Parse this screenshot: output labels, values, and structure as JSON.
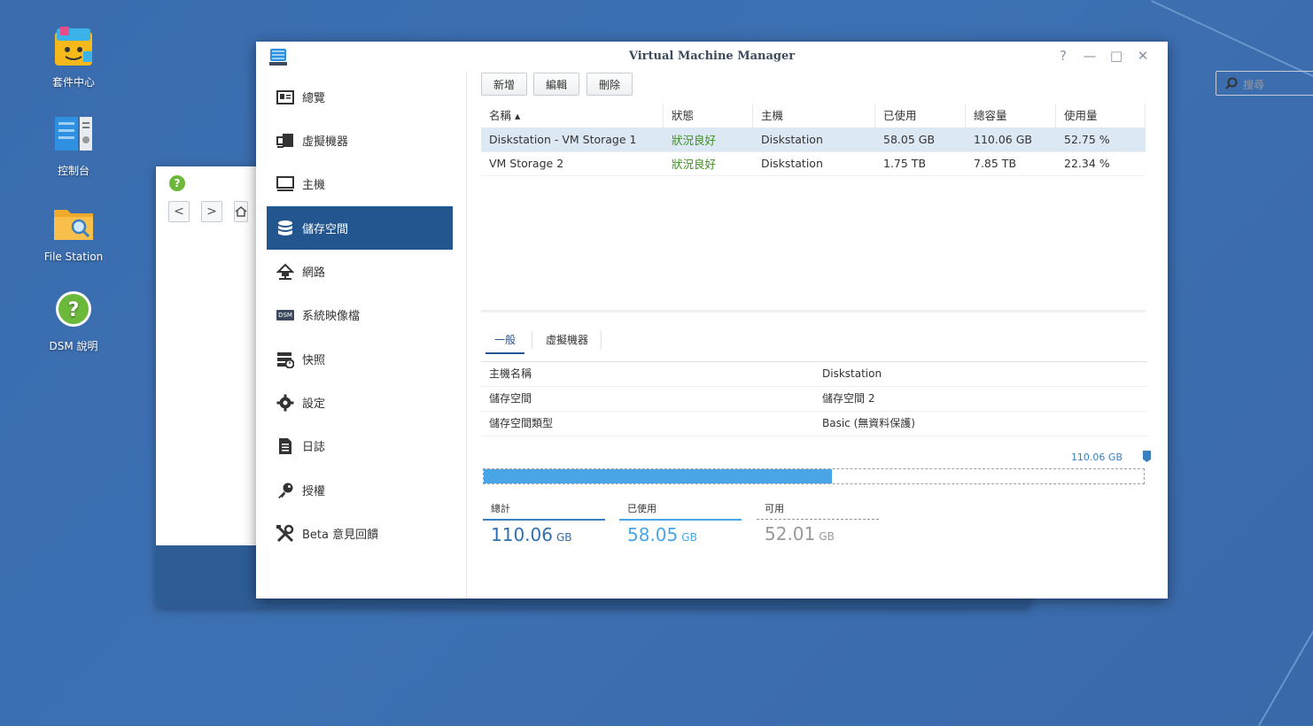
{
  "desktop": {
    "icons": [
      {
        "label": "套件中心"
      },
      {
        "label": "控制台"
      },
      {
        "label": "File Station"
      },
      {
        "label": "DSM 說明"
      }
    ]
  },
  "background_window": {
    "help_icon": "?",
    "back": "<",
    "forward": ">"
  },
  "window": {
    "title": "Virtual Machine Manager",
    "controls": {
      "help": "?",
      "minimize": "—",
      "maximize": "□",
      "close": "✕"
    }
  },
  "sidebar": {
    "items": [
      {
        "label": "總覽",
        "icon": "overview-icon"
      },
      {
        "label": "虛擬機器",
        "icon": "vm-icon"
      },
      {
        "label": "主機",
        "icon": "host-icon"
      },
      {
        "label": "儲存空間",
        "icon": "storage-icon",
        "active": true
      },
      {
        "label": "網路",
        "icon": "network-icon"
      },
      {
        "label": "系統映像檔",
        "icon": "image-icon",
        "badge": "DSM"
      },
      {
        "label": "快照",
        "icon": "snapshot-icon"
      },
      {
        "label": "設定",
        "icon": "settings-icon"
      },
      {
        "label": "日誌",
        "icon": "log-icon"
      },
      {
        "label": "授權",
        "icon": "key-icon"
      },
      {
        "label": "Beta 意見回饋",
        "icon": "tools-icon"
      }
    ]
  },
  "toolbar": {
    "add": "新增",
    "edit": "編輯",
    "delete": "刪除",
    "search_placeholder": "搜尋"
  },
  "table": {
    "headers": [
      "名稱 ▴",
      "狀態",
      "主機",
      "已使用",
      "總容量",
      "使用量"
    ],
    "rows": [
      [
        "Diskstation - VM Storage 1",
        "狀況良好",
        "Diskstation",
        "58.05 GB",
        "110.06 GB",
        "52.75 %"
      ],
      [
        "VM Storage 2",
        "狀況良好",
        "Diskstation",
        "1.75 TB",
        "7.85 TB",
        "22.34 %"
      ]
    ],
    "selected_row": 0
  },
  "detail": {
    "tabs": [
      "一般",
      "虛擬機器"
    ],
    "active_tab": 0,
    "properties": [
      {
        "key": "主機名稱",
        "value": "Diskstation"
      },
      {
        "key": "儲存空間",
        "value": "儲存空間 2"
      },
      {
        "key": "儲存空間類型",
        "value": "Basic (無資料保護)"
      }
    ],
    "capacity_label": "110.06 GB",
    "usage_fraction": 0.5275,
    "stats": [
      {
        "label": "總計",
        "value": "110.06",
        "unit": "GB"
      },
      {
        "label": "已使用",
        "value": "58.05",
        "unit": "GB"
      },
      {
        "label": "可用",
        "value": "52.01",
        "unit": "GB"
      }
    ]
  },
  "colors": {
    "accent": "#23568f",
    "bar": "#4aa5e6",
    "ok": "#3b8f1e"
  }
}
